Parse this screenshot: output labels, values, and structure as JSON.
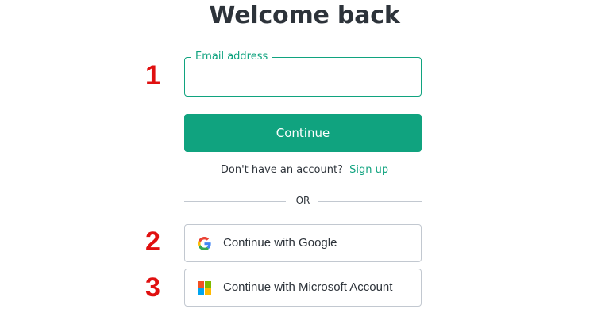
{
  "page": {
    "title": "Welcome back"
  },
  "markers": [
    "1",
    "2",
    "3"
  ],
  "email": {
    "label": "Email address",
    "value": "",
    "accent_color": "#10a37f"
  },
  "continue_button": {
    "label": "Continue",
    "color": "#10a37f"
  },
  "signup": {
    "prompt": "Don't have an account?",
    "link_label": "Sign up"
  },
  "divider": {
    "text": "OR"
  },
  "social": {
    "google": {
      "label": "Continue with Google",
      "icon": "google-icon"
    },
    "microsoft": {
      "label": "Continue with Microsoft Account",
      "icon": "microsoft-icon"
    }
  },
  "colors": {
    "marker": "#e01010",
    "border": "#c2c8d0",
    "text": "#2d333a"
  }
}
